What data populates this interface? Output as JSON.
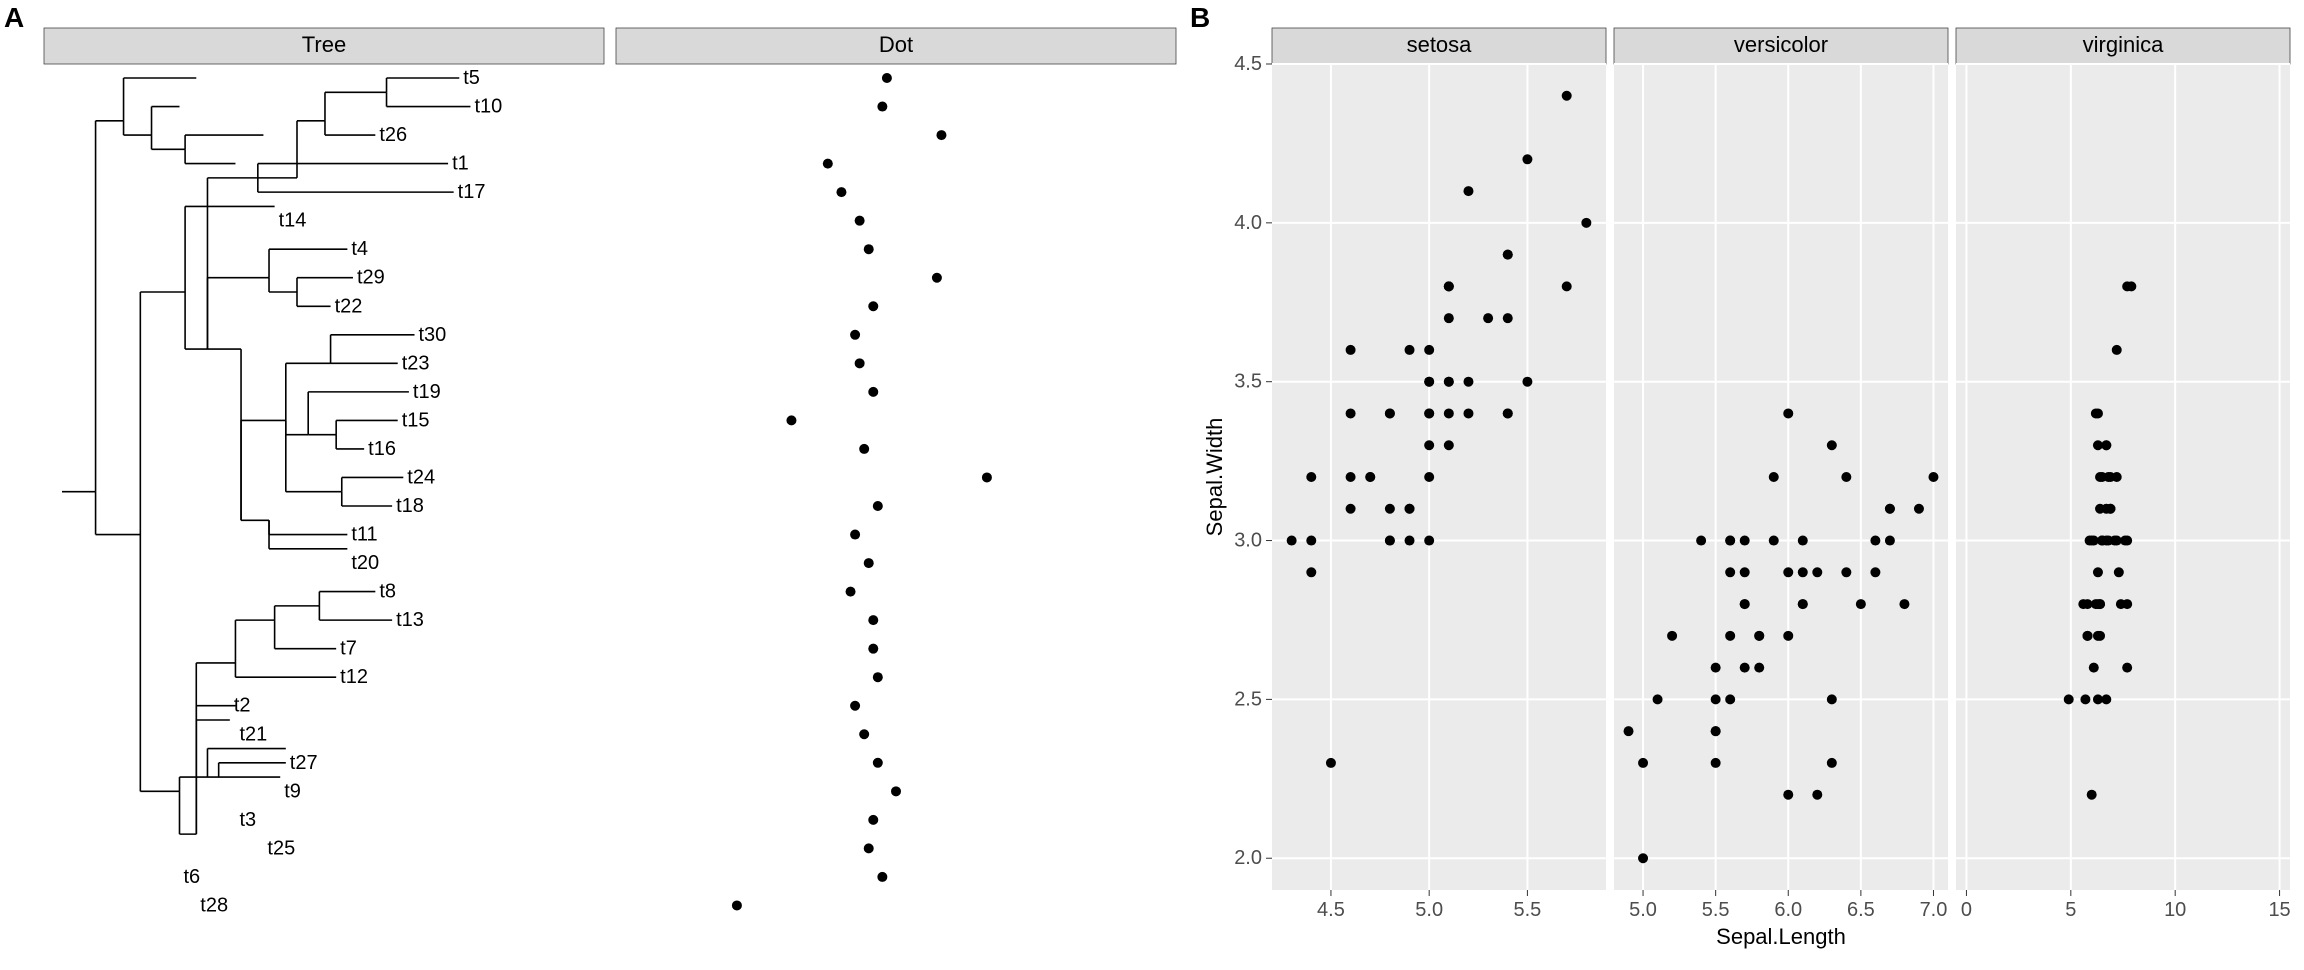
{
  "panelA": {
    "label": "A",
    "strips": [
      "Tree",
      "Dot"
    ],
    "tree": {
      "xlim": [
        0,
        4.2
      ],
      "tips": [
        "t5",
        "t10",
        "t26",
        "t1",
        "t17",
        "t14",
        "t4",
        "t29",
        "t22",
        "t30",
        "t23",
        "t19",
        "t15",
        "t16",
        "t24",
        "t18",
        "t11",
        "t20",
        "t8",
        "t13",
        "t7",
        "t12",
        "t2",
        "t21",
        "t27",
        "t9",
        "t3",
        "t25",
        "t6",
        "t28"
      ],
      "tip_x": [
        3.55,
        3.65,
        2.8,
        3.45,
        3.5,
        1.9,
        2.55,
        2.6,
        2.4,
        3.15,
        3.0,
        3.1,
        3.0,
        2.7,
        3.05,
        2.95,
        2.55,
        2.55,
        2.8,
        2.95,
        2.45,
        2.45,
        1.5,
        1.55,
        2.0,
        1.95,
        1.55,
        1.8,
        1.05,
        1.2
      ],
      "newick_xy": [
        [
          0.0,
          15.5,
          0.3,
          15.5
        ],
        [
          0.3,
          15.5,
          0.3,
          28.5
        ],
        [
          0.3,
          28.5,
          0.55,
          28.5
        ],
        [
          0.55,
          28.5,
          0.55,
          30.0
        ],
        [
          0.55,
          30.0,
          1.2,
          30.0
        ],
        [
          0.55,
          28.5,
          0.55,
          28.0
        ],
        [
          0.55,
          28.0,
          0.8,
          28.0
        ],
        [
          0.8,
          28.0,
          0.8,
          29.0
        ],
        [
          0.8,
          29.0,
          1.05,
          29.0
        ],
        [
          0.8,
          28.0,
          0.8,
          27.5
        ],
        [
          0.8,
          27.5,
          1.1,
          27.5
        ],
        [
          1.1,
          27.5,
          1.1,
          28.0
        ],
        [
          1.1,
          28.0,
          1.8,
          28.0
        ],
        [
          1.1,
          27.5,
          1.1,
          27.0
        ],
        [
          1.1,
          27.0,
          1.55,
          27.0
        ],
        [
          0.3,
          15.5,
          0.3,
          14.0
        ],
        [
          0.3,
          14.0,
          0.7,
          14.0
        ],
        [
          0.7,
          14.0,
          0.7,
          22.5
        ],
        [
          0.7,
          22.5,
          1.1,
          22.5
        ],
        [
          1.1,
          22.5,
          1.1,
          25.5
        ],
        [
          1.1,
          25.5,
          1.9,
          25.5
        ],
        [
          1.1,
          22.5,
          1.1,
          20.5
        ],
        [
          1.1,
          20.5,
          1.3,
          20.5
        ],
        [
          0.7,
          14.0,
          0.7,
          5.0
        ],
        [
          0.7,
          5.0,
          1.05,
          5.0
        ],
        [
          1.05,
          5.0,
          1.05,
          5.5
        ],
        [
          1.05,
          5.5,
          1.3,
          5.5
        ],
        [
          1.3,
          5.5,
          1.3,
          6.5
        ],
        [
          1.3,
          6.5,
          2.0,
          6.5
        ],
        [
          1.3,
          5.5,
          1.3,
          5.5
        ],
        [
          1.3,
          5.5,
          1.95,
          5.5
        ],
        [
          1.4,
          5.5,
          1.4,
          6.0
        ],
        [
          1.4,
          6.0,
          2.0,
          6.0
        ],
        [
          1.05,
          5.0,
          1.05,
          3.5
        ],
        [
          1.05,
          3.5,
          1.2,
          3.5
        ],
        [
          1.2,
          3.5,
          1.2,
          7.5
        ],
        [
          1.2,
          7.5,
          1.5,
          7.5
        ],
        [
          1.2,
          3.5,
          1.2,
          8.0
        ],
        [
          1.2,
          8.0,
          1.55,
          8.0
        ],
        [
          1.3,
          20.5,
          1.3,
          26.5
        ],
        [
          1.3,
          26.5,
          1.75,
          26.5
        ],
        [
          1.75,
          26.5,
          1.75,
          27.0
        ],
        [
          1.75,
          27.0,
          3.45,
          27.0
        ],
        [
          1.75,
          26.5,
          1.75,
          26.0
        ],
        [
          1.75,
          26.0,
          3.5,
          26.0
        ],
        [
          1.75,
          26.5,
          2.1,
          26.5
        ],
        [
          2.1,
          26.5,
          2.1,
          28.5
        ],
        [
          2.1,
          28.5,
          2.35,
          28.5
        ],
        [
          2.35,
          28.5,
          2.35,
          28.0
        ],
        [
          2.35,
          28.0,
          2.8,
          28.0
        ],
        [
          2.35,
          28.5,
          2.35,
          29.5
        ],
        [
          2.35,
          29.5,
          2.9,
          29.5
        ],
        [
          2.9,
          29.5,
          2.9,
          30.0
        ],
        [
          2.9,
          30.0,
          3.55,
          30.0
        ],
        [
          2.9,
          29.5,
          2.9,
          29.0
        ],
        [
          2.9,
          29.0,
          3.65,
          29.0
        ],
        [
          1.3,
          20.5,
          1.3,
          23.0
        ],
        [
          1.3,
          23.0,
          1.85,
          23.0
        ],
        [
          1.85,
          23.0,
          1.85,
          24.0
        ],
        [
          1.85,
          24.0,
          2.55,
          24.0
        ],
        [
          1.85,
          23.0,
          1.85,
          22.5
        ],
        [
          1.85,
          22.5,
          2.1,
          22.5
        ],
        [
          2.1,
          22.5,
          2.1,
          23.0
        ],
        [
          2.1,
          23.0,
          2.6,
          23.0
        ],
        [
          2.1,
          22.5,
          2.1,
          22.0
        ],
        [
          2.1,
          22.0,
          2.4,
          22.0
        ],
        [
          1.3,
          20.5,
          1.6,
          20.5
        ],
        [
          1.6,
          20.5,
          1.6,
          14.5
        ],
        [
          1.6,
          14.5,
          1.85,
          14.5
        ],
        [
          1.85,
          14.5,
          1.85,
          13.5
        ],
        [
          1.85,
          13.5,
          2.55,
          13.5
        ],
        [
          1.85,
          14.5,
          1.85,
          14.0
        ],
        [
          1.85,
          14.0,
          2.55,
          14.0
        ],
        [
          1.6,
          14.5,
          1.6,
          18.0
        ],
        [
          1.6,
          18.0,
          2.0,
          18.0
        ],
        [
          2.0,
          18.0,
          2.0,
          20.0
        ],
        [
          2.0,
          20.0,
          2.4,
          20.0
        ],
        [
          2.4,
          20.0,
          2.4,
          21.0
        ],
        [
          2.4,
          21.0,
          3.15,
          21.0
        ],
        [
          2.4,
          20.0,
          2.4,
          20.0
        ],
        [
          2.4,
          20.0,
          3.0,
          20.0
        ],
        [
          2.0,
          18.0,
          2.0,
          17.5
        ],
        [
          2.0,
          17.5,
          2.2,
          17.5
        ],
        [
          2.2,
          17.5,
          2.2,
          19.0
        ],
        [
          2.2,
          19.0,
          3.1,
          19.0
        ],
        [
          2.2,
          17.5,
          2.2,
          17.5
        ],
        [
          2.2,
          17.5,
          2.45,
          17.5
        ],
        [
          2.45,
          17.5,
          2.45,
          18.0
        ],
        [
          2.45,
          18.0,
          3.0,
          18.0
        ],
        [
          2.45,
          17.5,
          2.45,
          17.0
        ],
        [
          2.45,
          17.0,
          2.7,
          17.0
        ],
        [
          2.0,
          18.0,
          2.0,
          15.5
        ],
        [
          2.0,
          15.5,
          2.5,
          15.5
        ],
        [
          2.5,
          15.5,
          2.5,
          16.0
        ],
        [
          2.5,
          16.0,
          3.05,
          16.0
        ],
        [
          2.5,
          15.5,
          2.5,
          15.0
        ],
        [
          2.5,
          15.0,
          2.95,
          15.0
        ],
        [
          1.2,
          3.5,
          1.2,
          9.5
        ],
        [
          1.2,
          9.5,
          1.55,
          9.5
        ],
        [
          1.55,
          9.5,
          1.55,
          9.0
        ],
        [
          1.55,
          9.0,
          2.45,
          9.0
        ],
        [
          1.55,
          9.5,
          1.55,
          11.0
        ],
        [
          1.55,
          11.0,
          1.9,
          11.0
        ],
        [
          1.9,
          11.0,
          1.9,
          10.0
        ],
        [
          1.9,
          10.0,
          2.45,
          10.0
        ],
        [
          1.9,
          11.0,
          1.9,
          11.5
        ],
        [
          1.9,
          11.5,
          2.3,
          11.5
        ],
        [
          2.3,
          11.5,
          2.3,
          12.0
        ],
        [
          2.3,
          12.0,
          2.8,
          12.0
        ],
        [
          2.3,
          11.5,
          2.3,
          11.0
        ],
        [
          2.3,
          11.0,
          2.95,
          11.0
        ]
      ]
    },
    "dot": {
      "xlim": [
        -2.2,
        3.3
      ],
      "values": [
        0.45,
        0.4,
        1.05,
        -0.2,
        -0.05,
        0.15,
        0.25,
        1.0,
        0.3,
        0.1,
        0.15,
        0.3,
        -0.6,
        0.2,
        1.55,
        0.35,
        0.1,
        0.25,
        0.05,
        0.3,
        0.3,
        0.35,
        0.1,
        0.2,
        0.35,
        0.55,
        0.3,
        0.25,
        0.4,
        -1.2
      ]
    }
  },
  "panelB": {
    "label": "B",
    "facets": [
      "setosa",
      "versicolor",
      "virginica"
    ],
    "axis_x": "Sepal.Length",
    "axis_y": "Sepal.Width",
    "xlim": [
      -0.5,
      15.5
    ],
    "ylim": [
      1.9,
      4.5
    ],
    "xticks": {
      "setosa_versicolor": [
        4.5,
        5.0,
        5.5,
        6.0,
        6.5,
        7.0
      ],
      "virginica": [
        0,
        5,
        10,
        15
      ]
    },
    "yticks": [
      2.0,
      2.5,
      3.0,
      3.5,
      4.0,
      4.5
    ]
  },
  "chart_data": [
    {
      "type": "tree",
      "title": "Tree",
      "categories": [
        "t5",
        "t10",
        "t26",
        "t1",
        "t17",
        "t14",
        "t4",
        "t29",
        "t22",
        "t30",
        "t23",
        "t19",
        "t15",
        "t16",
        "t24",
        "t18",
        "t11",
        "t20",
        "t8",
        "t13",
        "t7",
        "t12",
        "t2",
        "t21",
        "t27",
        "t9",
        "t3",
        "t25",
        "t6",
        "t28"
      ]
    },
    {
      "type": "scatter",
      "title": "Dot",
      "x": [
        0.45,
        0.4,
        1.05,
        -0.2,
        -0.05,
        0.15,
        0.25,
        1.0,
        0.3,
        0.1,
        0.15,
        0.3,
        -0.6,
        0.2,
        1.55,
        0.35,
        0.1,
        0.25,
        0.05,
        0.3,
        0.3,
        0.35,
        0.1,
        0.2,
        0.35,
        0.55,
        0.3,
        0.25,
        0.4,
        -1.2
      ],
      "categories": [
        "t5",
        "t10",
        "t26",
        "t1",
        "t17",
        "t14",
        "t4",
        "t29",
        "t22",
        "t30",
        "t23",
        "t19",
        "t15",
        "t16",
        "t24",
        "t18",
        "t11",
        "t20",
        "t8",
        "t13",
        "t7",
        "t12",
        "t2",
        "t21",
        "t27",
        "t9",
        "t3",
        "t25",
        "t6",
        "t28"
      ]
    },
    {
      "type": "scatter",
      "title": "setosa",
      "xlabel": "Sepal.Length",
      "ylabel": "Sepal.Width",
      "x": [
        5.1,
        4.9,
        4.7,
        4.6,
        5.0,
        5.4,
        4.6,
        5.0,
        4.4,
        4.9,
        5.4,
        4.8,
        4.8,
        4.3,
        5.8,
        5.7,
        5.4,
        5.1,
        5.7,
        5.1,
        5.4,
        5.1,
        4.6,
        5.1,
        4.8,
        5.0,
        5.0,
        5.2,
        5.2,
        4.7,
        4.8,
        5.4,
        5.2,
        5.5,
        4.9,
        5.0,
        5.5,
        4.9,
        4.4,
        5.1,
        5.0,
        4.5,
        4.4,
        5.0,
        5.1,
        4.8,
        5.1,
        4.6,
        5.3,
        5.0
      ],
      "y": [
        3.5,
        3.0,
        3.2,
        3.1,
        3.6,
        3.9,
        3.4,
        3.4,
        2.9,
        3.1,
        3.7,
        3.4,
        3.0,
        3.0,
        4.0,
        4.4,
        3.9,
        3.5,
        3.8,
        3.8,
        3.4,
        3.7,
        3.6,
        3.3,
        3.4,
        3.0,
        3.4,
        3.5,
        3.4,
        3.2,
        3.1,
        3.4,
        4.1,
        4.2,
        3.1,
        3.2,
        3.5,
        3.6,
        3.0,
        3.4,
        3.5,
        2.3,
        3.2,
        3.5,
        3.8,
        3.0,
        3.8,
        3.2,
        3.7,
        3.3
      ]
    },
    {
      "type": "scatter",
      "title": "versicolor",
      "xlabel": "Sepal.Length",
      "ylabel": "Sepal.Width",
      "x": [
        7.0,
        6.4,
        6.9,
        5.5,
        6.5,
        5.7,
        6.3,
        4.9,
        6.6,
        5.2,
        5.0,
        5.9,
        6.0,
        6.1,
        5.6,
        6.7,
        5.6,
        5.8,
        6.2,
        5.6,
        5.9,
        6.1,
        6.3,
        6.1,
        6.4,
        6.6,
        6.8,
        6.7,
        6.0,
        5.7,
        5.5,
        5.5,
        5.8,
        6.0,
        5.4,
        6.0,
        6.7,
        6.3,
        5.6,
        5.5,
        5.5,
        6.1,
        5.8,
        5.0,
        5.6,
        5.7,
        5.7,
        6.2,
        5.1,
        5.7
      ],
      "y": [
        3.2,
        3.2,
        3.1,
        2.3,
        2.8,
        2.8,
        3.3,
        2.4,
        2.9,
        2.7,
        2.0,
        3.0,
        2.2,
        2.9,
        2.9,
        3.1,
        3.0,
        2.7,
        2.2,
        2.5,
        3.2,
        2.8,
        2.5,
        2.8,
        2.9,
        3.0,
        2.8,
        3.0,
        2.9,
        2.6,
        2.4,
        2.4,
        2.7,
        2.7,
        3.0,
        3.4,
        3.1,
        2.3,
        3.0,
        2.5,
        2.6,
        3.0,
        2.6,
        2.3,
        2.7,
        3.0,
        2.9,
        2.9,
        2.5,
        2.8
      ]
    },
    {
      "type": "scatter",
      "title": "virginica",
      "xlabel": "Sepal.Length",
      "ylabel": "Sepal.Width",
      "x": [
        6.3,
        5.8,
        7.1,
        6.3,
        6.5,
        7.6,
        4.9,
        7.3,
        6.7,
        7.2,
        6.5,
        6.4,
        6.8,
        5.7,
        5.8,
        6.4,
        6.5,
        7.7,
        7.7,
        6.0,
        6.9,
        5.6,
        7.7,
        6.3,
        6.7,
        7.2,
        6.2,
        6.1,
        6.4,
        7.2,
        7.4,
        7.9,
        6.4,
        6.3,
        6.1,
        7.7,
        6.3,
        6.4,
        6.0,
        6.9,
        6.7,
        6.9,
        5.8,
        6.8,
        6.7,
        6.7,
        6.3,
        6.5,
        6.2,
        5.9
      ],
      "y": [
        3.3,
        2.7,
        3.0,
        2.9,
        3.0,
        3.0,
        2.5,
        2.9,
        2.5,
        3.6,
        3.2,
        2.7,
        3.0,
        2.5,
        2.8,
        3.2,
        3.0,
        3.8,
        2.6,
        2.2,
        3.2,
        2.8,
        2.8,
        2.7,
        3.3,
        3.2,
        2.8,
        3.0,
        2.8,
        3.0,
        2.8,
        3.8,
        2.8,
        2.8,
        2.6,
        3.0,
        3.4,
        3.1,
        3.0,
        3.1,
        3.1,
        3.1,
        2.7,
        3.2,
        3.3,
        3.0,
        2.5,
        3.0,
        3.4,
        3.0
      ]
    }
  ]
}
